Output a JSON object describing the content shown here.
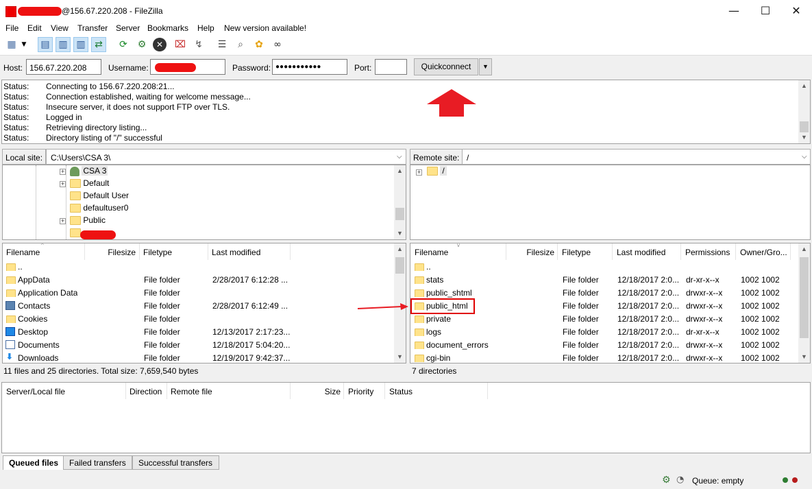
{
  "window": {
    "title": "@156.67.220.208 - FileZilla",
    "minimize_glyph": "—",
    "maximize_glyph": "☐",
    "close_glyph": "✕"
  },
  "menu": [
    "File",
    "Edit",
    "View",
    "Transfer",
    "Server",
    "Bookmarks",
    "Help",
    "New version available!"
  ],
  "toolbar_icons": [
    "site-manager-icon",
    "dropdown-arrow-icon",
    "toggle-log-icon",
    "toggle-local-tree-icon",
    "toggle-remote-tree-icon",
    "toggle-queue-icon",
    "refresh-icon",
    "process-queue-icon",
    "cancel-icon",
    "disconnect-icon",
    "reconnect-icon",
    "directory-comparison-icon",
    "filter-icon",
    "sync-browsing-icon",
    "search-icon"
  ],
  "quickconnect": {
    "host_label": "Host:",
    "host_value": "156.67.220.208",
    "username_label": "Username:",
    "username_value": "",
    "password_label": "Password:",
    "password_value": "●●●●●●●●●●●",
    "port_label": "Port:",
    "port_value": "",
    "button_label": "Quickconnect",
    "dropdown_glyph": "▼"
  },
  "log": [
    {
      "k": "Status:",
      "v": "Connecting to 156.67.220.208:21..."
    },
    {
      "k": "Status:",
      "v": "Connection established, waiting for welcome message..."
    },
    {
      "k": "Status:",
      "v": "Insecure server, it does not support FTP over TLS."
    },
    {
      "k": "Status:",
      "v": "Logged in"
    },
    {
      "k": "Status:",
      "v": "Retrieving directory listing..."
    },
    {
      "k": "Status:",
      "v": "Directory listing of \"/\" successful"
    }
  ],
  "local": {
    "site_label": "Local site:",
    "path": "C:\\Users\\CSA 3\\",
    "tree": [
      {
        "label": "CSA 3",
        "expand": true,
        "icon": "user-icon"
      },
      {
        "label": "Default",
        "expand": true,
        "icon": "folder-icon"
      },
      {
        "label": "Default User",
        "expand": false,
        "icon": "folder-icon"
      },
      {
        "label": "defaultuser0",
        "expand": false,
        "icon": "folder-icon"
      },
      {
        "label": "Public",
        "expand": true,
        "icon": "folder-icon"
      },
      {
        "label": "",
        "expand": false,
        "icon": "folder-icon"
      }
    ],
    "headers": [
      "Filename",
      "Filesize",
      "Filetype",
      "Last modified"
    ],
    "rows": [
      {
        "name": "..",
        "type": "",
        "modified": "",
        "icon": "folder"
      },
      {
        "name": "AppData",
        "type": "File folder",
        "modified": "2/28/2017 6:12:28 ...",
        "icon": "folder"
      },
      {
        "name": "Application Data",
        "type": "File folder",
        "modified": "",
        "icon": "folder"
      },
      {
        "name": "Contacts",
        "type": "File folder",
        "modified": "2/28/2017 6:12:49 ...",
        "icon": "contacts"
      },
      {
        "name": "Cookies",
        "type": "File folder",
        "modified": "",
        "icon": "folder"
      },
      {
        "name": "Desktop",
        "type": "File folder",
        "modified": "12/13/2017 2:17:23...",
        "icon": "desktop"
      },
      {
        "name": "Documents",
        "type": "File folder",
        "modified": "12/18/2017 5:04:20...",
        "icon": "documents"
      },
      {
        "name": "Downloads",
        "type": "File folder",
        "modified": "12/19/2017 9:42:37...",
        "icon": "downloads"
      }
    ],
    "status": "11 files and 25 directories. Total size: 7,659,540 bytes"
  },
  "remote": {
    "site_label": "Remote site:",
    "path": "/",
    "tree": [
      {
        "label": "/",
        "expand": true
      }
    ],
    "headers": [
      "Filename",
      "Filesize",
      "Filetype",
      "Last modified",
      "Permissions",
      "Owner/Gro..."
    ],
    "rows": [
      {
        "name": "..",
        "type": "",
        "modified": "",
        "perm": "",
        "owner": ""
      },
      {
        "name": "stats",
        "type": "File folder",
        "modified": "12/18/2017 2:0...",
        "perm": "dr-xr-x--x",
        "owner": "1002 1002"
      },
      {
        "name": "public_shtml",
        "type": "File folder",
        "modified": "12/18/2017 2:0...",
        "perm": "drwxr-x--x",
        "owner": "1002 1002"
      },
      {
        "name": "public_html",
        "type": "File folder",
        "modified": "12/18/2017 2:0...",
        "perm": "drwxr-x--x",
        "owner": "1002 1002"
      },
      {
        "name": "private",
        "type": "File folder",
        "modified": "12/18/2017 2:0...",
        "perm": "drwxr-x--x",
        "owner": "1002 1002"
      },
      {
        "name": "logs",
        "type": "File folder",
        "modified": "12/18/2017 2:0...",
        "perm": "dr-xr-x--x",
        "owner": "1002 1002"
      },
      {
        "name": "document_errors",
        "type": "File folder",
        "modified": "12/18/2017 2:0...",
        "perm": "drwxr-x--x",
        "owner": "1002 1002"
      },
      {
        "name": "cgi-bin",
        "type": "File folder",
        "modified": "12/18/2017 2:0...",
        "perm": "drwxr-x--x",
        "owner": "1002 1002"
      }
    ],
    "status": "7 directories"
  },
  "queue": {
    "headers": [
      "Server/Local file",
      "Direction",
      "Remote file",
      "Size",
      "Priority",
      "Status"
    ],
    "tabs": [
      "Queued files",
      "Failed transfers",
      "Successful transfers"
    ]
  },
  "statusbar": {
    "queue_text": "Queue: empty"
  },
  "colors": {
    "annotation_red": "#e81c24",
    "selection_box": "#e00000",
    "led_green": "#2e7d32",
    "led_red": "#b71c1c"
  }
}
